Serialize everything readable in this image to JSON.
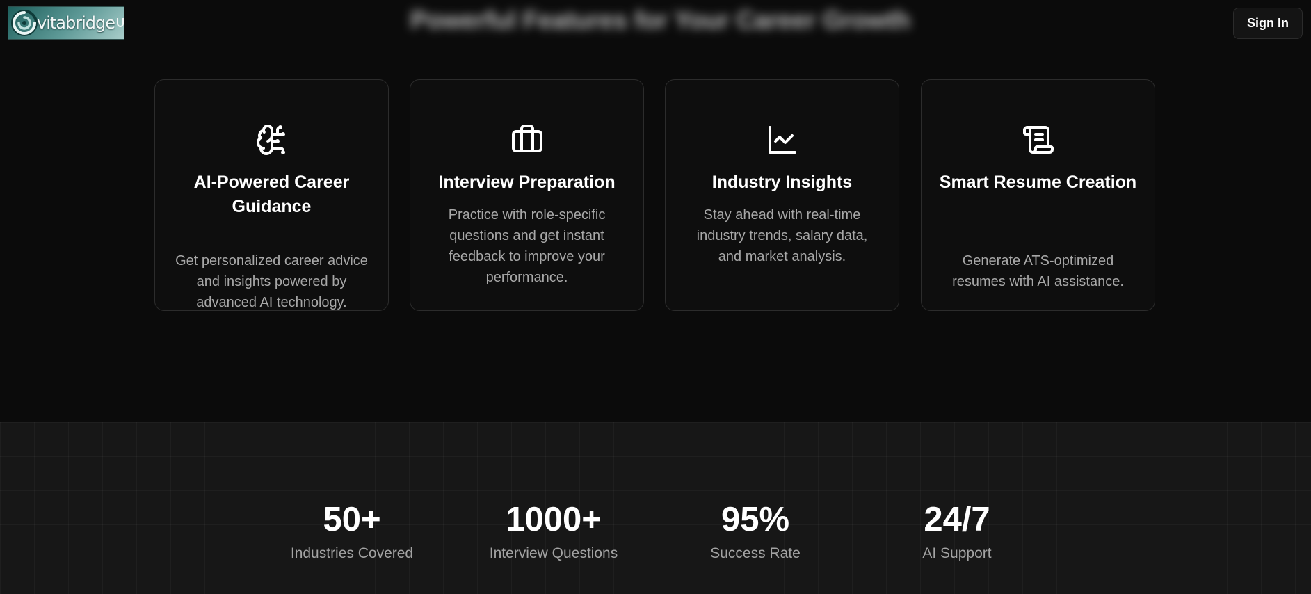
{
  "header": {
    "logo_text": "vitabridge",
    "blurred_heading": "Powerful Features for Your Career Growth",
    "signin_label": "Sign In"
  },
  "features": [
    {
      "icon": "brain-icon",
      "title": "AI-Powered Career Guidance",
      "description": "Get personalized career advice and insights powered by advanced AI technology."
    },
    {
      "icon": "briefcase-icon",
      "title": "Interview Preparation",
      "description": "Practice with role-specific questions and get instant feedback to improve your performance."
    },
    {
      "icon": "line-chart-icon",
      "title": "Industry Insights",
      "description": "Stay ahead with real-time industry trends, salary data, and market analysis."
    },
    {
      "icon": "scroll-text-icon",
      "title": "Smart Resume Creation",
      "description": "Generate ATS-optimized resumes with AI assistance."
    }
  ],
  "stats": [
    {
      "value": "50+",
      "label": "Industries Covered"
    },
    {
      "value": "1000+",
      "label": "Interview Questions"
    },
    {
      "value": "95%",
      "label": "Success Rate"
    },
    {
      "value": "24/7",
      "label": "AI Support"
    }
  ],
  "colors": {
    "background": "#0b0b0b",
    "card_border": "#2c2c2c",
    "stats_background": "#171717",
    "muted_text": "#a8a8a8",
    "logo_teal": "#5e9a97"
  }
}
